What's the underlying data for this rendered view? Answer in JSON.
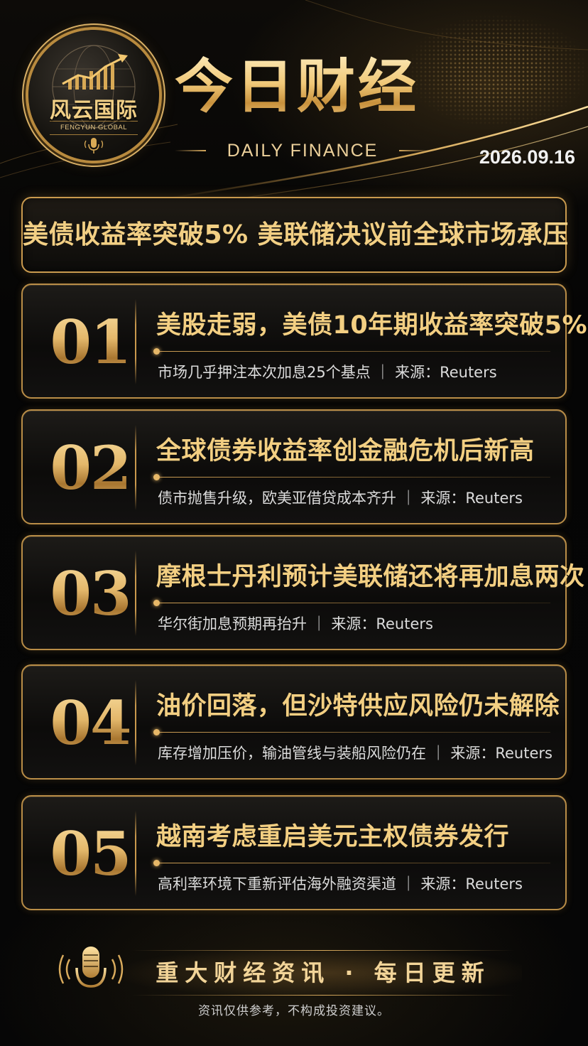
{
  "brand": {
    "name_cn": "风云国际",
    "name_en": "FENGYUN GLOBAL"
  },
  "header": {
    "title": "今日财经",
    "subtitle": "DAILY FINANCE",
    "date": "2026.09.16"
  },
  "headline": "美债收益率突破5% 美联储决议前全球市场承压",
  "news": [
    {
      "num": "01",
      "title": "美股走弱，美债10年期收益率突破5%",
      "summary": "市场几乎押注本次加息25个基点 ｜ 来源：Reuters"
    },
    {
      "num": "02",
      "title": "全球债券收益率创金融危机后新高",
      "summary": "债市抛售升级，欧美亚借贷成本齐升 ｜ 来源：Reuters"
    },
    {
      "num": "03",
      "title": "摩根士丹利预计美联储还将再加息两次",
      "summary": "华尔街加息预期再抬升 ｜ 来源：Reuters"
    },
    {
      "num": "04",
      "title": "油价回落，但沙特供应风险仍未解除",
      "summary": "库存增加压价，输油管线与装船风险仍在 ｜ 来源：Reuters"
    },
    {
      "num": "05",
      "title": "越南考虑重启美元主权债券发行",
      "summary": "高利率环境下重新评估海外融资渠道 ｜ 来源：Reuters"
    }
  ],
  "footer": {
    "slogan": "重大财经资讯 · 每日更新",
    "disclaimer": "资讯仅供参考，不构成投资建议。"
  },
  "colors": {
    "gold": "#f2cf84",
    "border_gold": "#c99a4e",
    "background": "#050505"
  },
  "icons": [
    "globe-icon",
    "chart-arrow-icon",
    "microphone-icon"
  ]
}
